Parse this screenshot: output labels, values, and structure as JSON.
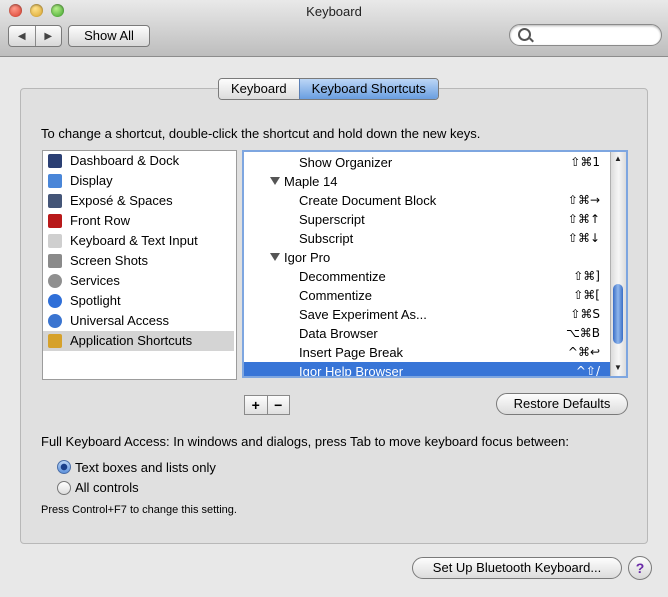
{
  "window": {
    "title": "Keyboard"
  },
  "toolbar": {
    "back_icon": "◀",
    "forward_icon": "▶",
    "show_all": "Show All",
    "search_placeholder": ""
  },
  "tabs": [
    {
      "label": "Keyboard",
      "active": false
    },
    {
      "label": "Keyboard Shortcuts",
      "active": true
    }
  ],
  "instructions": "To change a shortcut, double-click the shortcut and hold down the new keys.",
  "categories": [
    {
      "label": "Dashboard & Dock",
      "icon": "dashboard-dock-icon",
      "color": "#2b3f73"
    },
    {
      "label": "Display",
      "icon": "display-icon",
      "color": "#4a86d8"
    },
    {
      "label": "Exposé & Spaces",
      "icon": "expose-spaces-icon",
      "color": "#445577"
    },
    {
      "label": "Front Row",
      "icon": "front-row-icon",
      "color": "#b8191a"
    },
    {
      "label": "Keyboard & Text Input",
      "icon": "keyboard-icon",
      "color": "#cfcfcf"
    },
    {
      "label": "Screen Shots",
      "icon": "camera-icon",
      "color": "#8a8a8a"
    },
    {
      "label": "Services",
      "icon": "gear-icon",
      "color": "#8f8f8f"
    },
    {
      "label": "Spotlight",
      "icon": "spotlight-icon",
      "color": "#2f6fd8"
    },
    {
      "label": "Universal Access",
      "icon": "universal-access-icon",
      "color": "#3a74d0"
    },
    {
      "label": "Application Shortcuts",
      "icon": "application-shortcuts-icon",
      "color": "#d6a12a",
      "selected": true
    }
  ],
  "shortcuts": [
    {
      "kind": "item",
      "label": "Show Organizer",
      "keys": "⇧⌘1"
    },
    {
      "kind": "group",
      "label": "Maple 14",
      "keys": ""
    },
    {
      "kind": "item",
      "label": "Create Document Block",
      "keys": "⇧⌘→"
    },
    {
      "kind": "item",
      "label": "Superscript",
      "keys": "⇧⌘↑"
    },
    {
      "kind": "item",
      "label": "Subscript",
      "keys": "⇧⌘↓"
    },
    {
      "kind": "group",
      "label": "Igor Pro",
      "keys": ""
    },
    {
      "kind": "item",
      "label": "Decommentize",
      "keys": "⇧⌘]"
    },
    {
      "kind": "item",
      "label": "Commentize",
      "keys": "⇧⌘["
    },
    {
      "kind": "item",
      "label": "Save Experiment As...",
      "keys": "⇧⌘S"
    },
    {
      "kind": "item",
      "label": "Data Browser",
      "keys": "⌥⌘B"
    },
    {
      "kind": "item",
      "label": "Insert Page Break",
      "keys": "^⌘↩"
    },
    {
      "kind": "item",
      "label": "Igor Help Browser",
      "keys": "^⇧/",
      "selected": true
    }
  ],
  "list_controls": {
    "add": "+",
    "remove": "−"
  },
  "restore_defaults": "Restore Defaults",
  "full_keyboard_access": {
    "label": "Full Keyboard Access: In windows and dialogs, press Tab to move keyboard focus between:",
    "options": [
      {
        "label": "Text boxes and lists only",
        "selected": true
      },
      {
        "label": "All controls",
        "selected": false
      }
    ],
    "note": "Press Control+F7 to change this setting."
  },
  "bluetooth_button": "Set Up Bluetooth Keyboard...",
  "help_button": "?",
  "colors": {
    "selection": "#3875d7",
    "focus_ring": "#7ea6e0"
  }
}
